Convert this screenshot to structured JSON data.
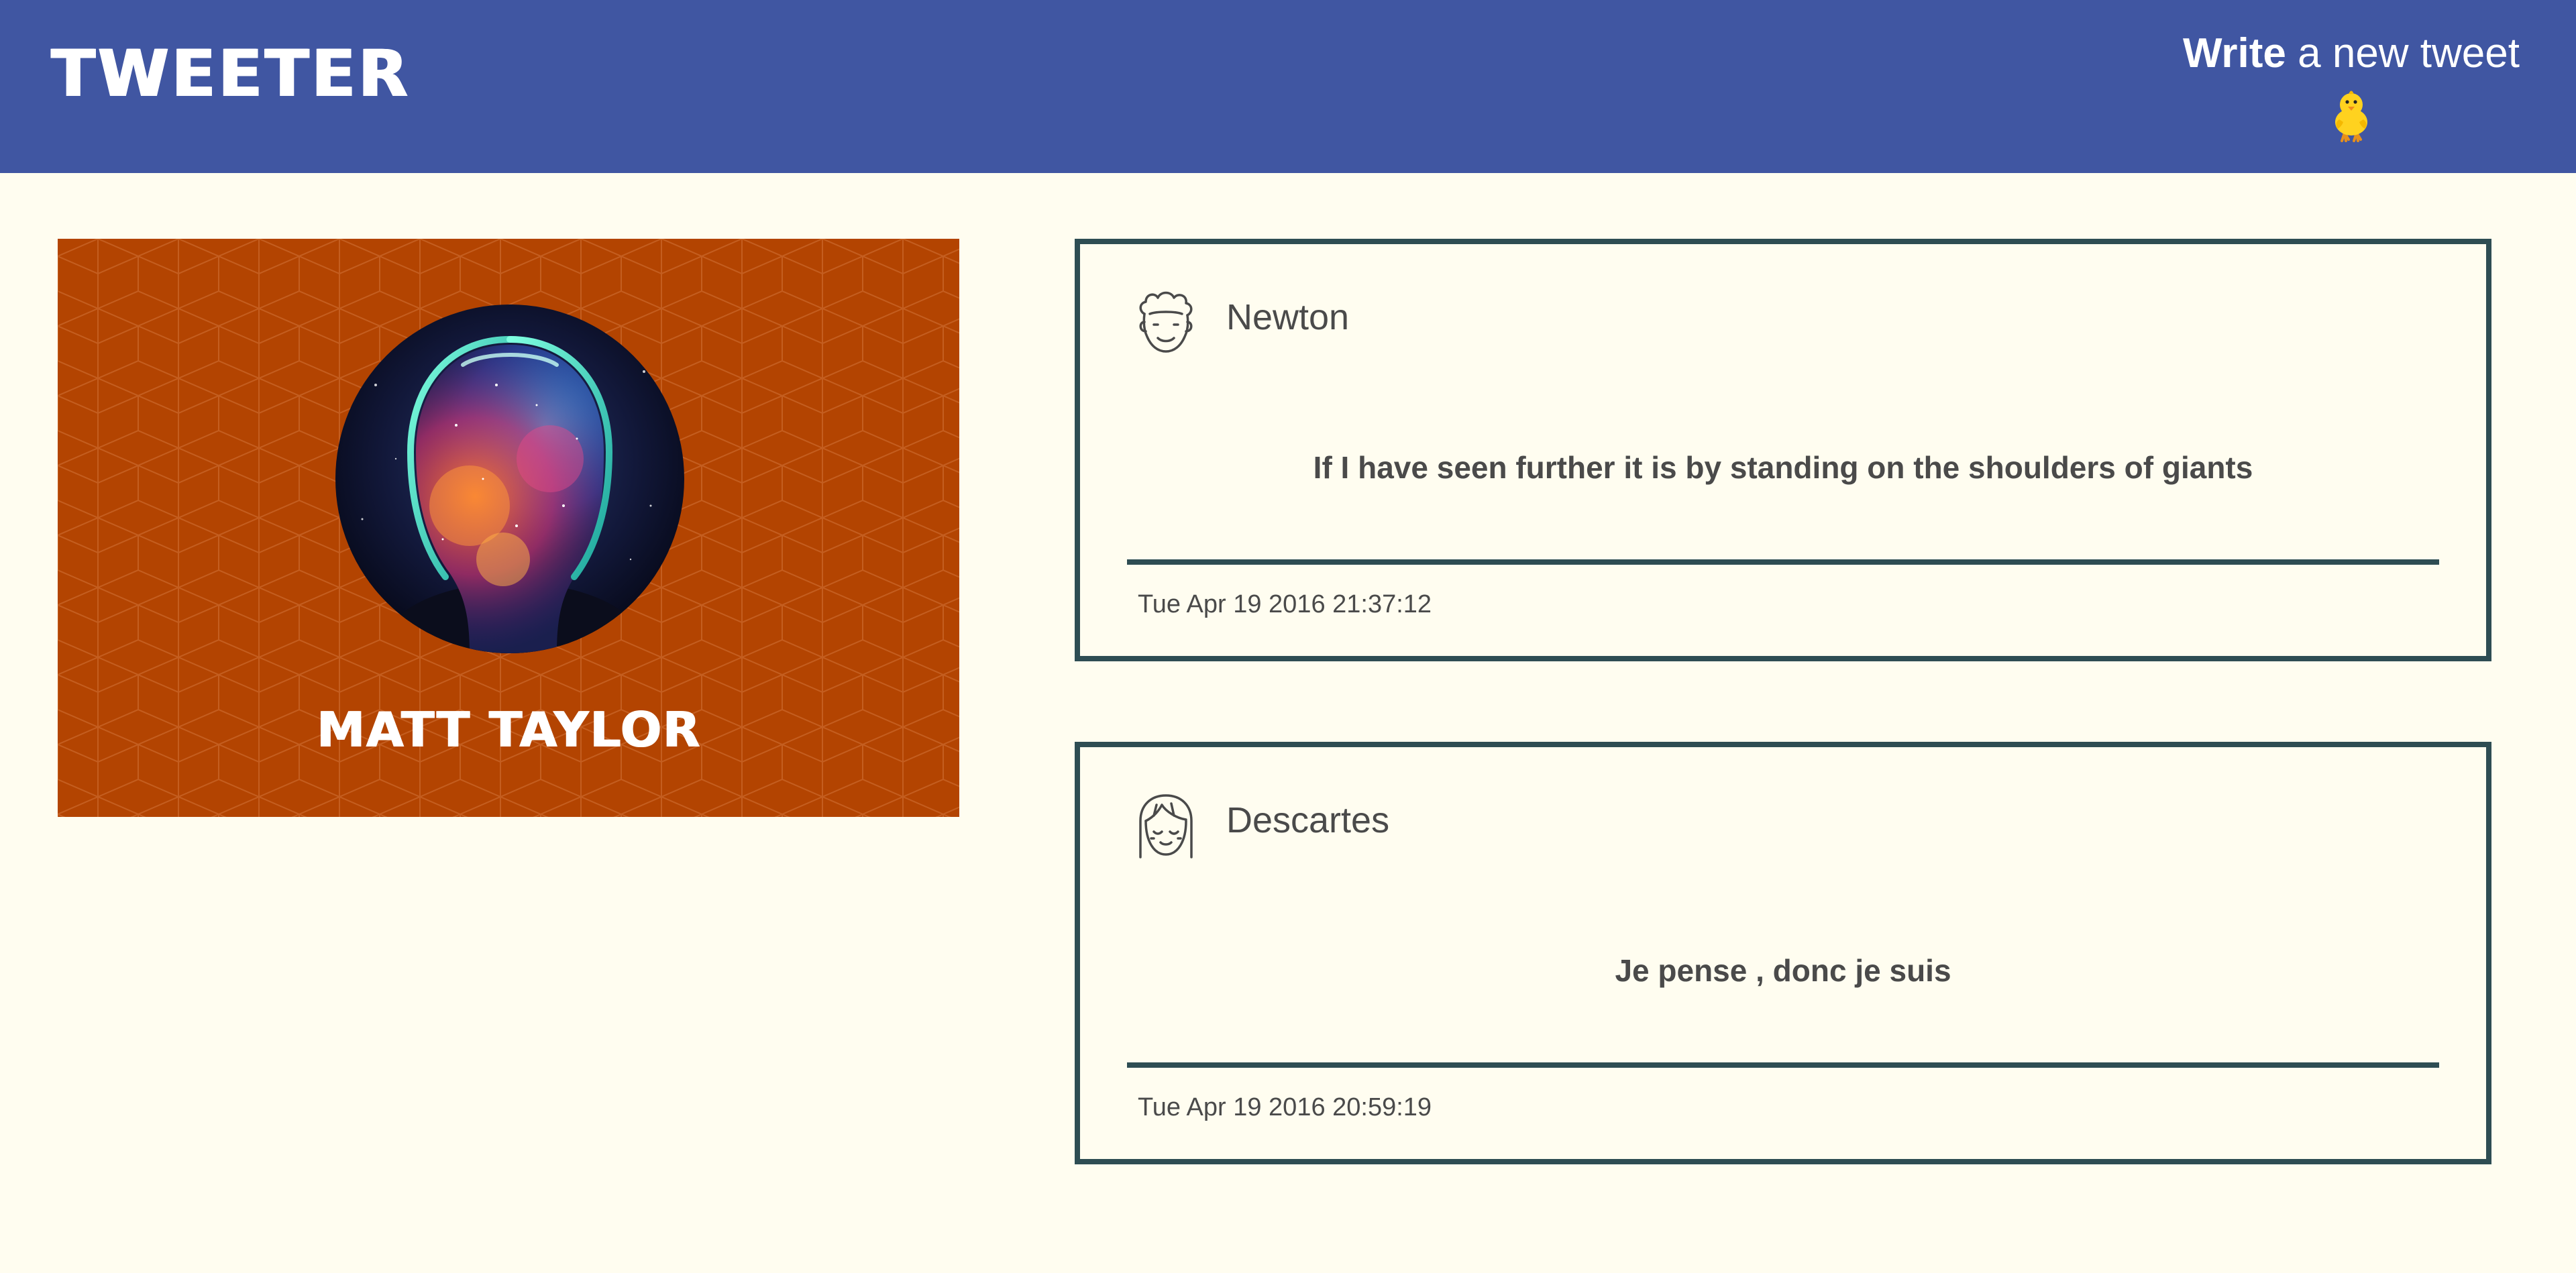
{
  "header": {
    "brand": "TWEETER",
    "compose_bold": "Write",
    "compose_rest": " a new tweet",
    "compose_icon": "chick-icon"
  },
  "profile": {
    "name": "MATT TAYLOR",
    "background_color": "#b34401",
    "avatar_icon": "cosmic-head-avatar"
  },
  "tweets": [
    {
      "username": "Newton",
      "avatar_icon": "curly-hair-face-icon",
      "content": "If I have seen further it is by standing on the shoulders of giants",
      "timestamp": "Tue Apr 19 2016 21:37:12"
    },
    {
      "username": "Descartes",
      "avatar_icon": "bangs-face-icon",
      "content": "Je pense , donc je suis",
      "timestamp": "Tue Apr 19 2016 20:59:19"
    }
  ],
  "colors": {
    "navbar": "#4056a2",
    "page_background": "#fffdf0",
    "tweet_border": "#2e4d53",
    "text": "#4a4a4a"
  }
}
